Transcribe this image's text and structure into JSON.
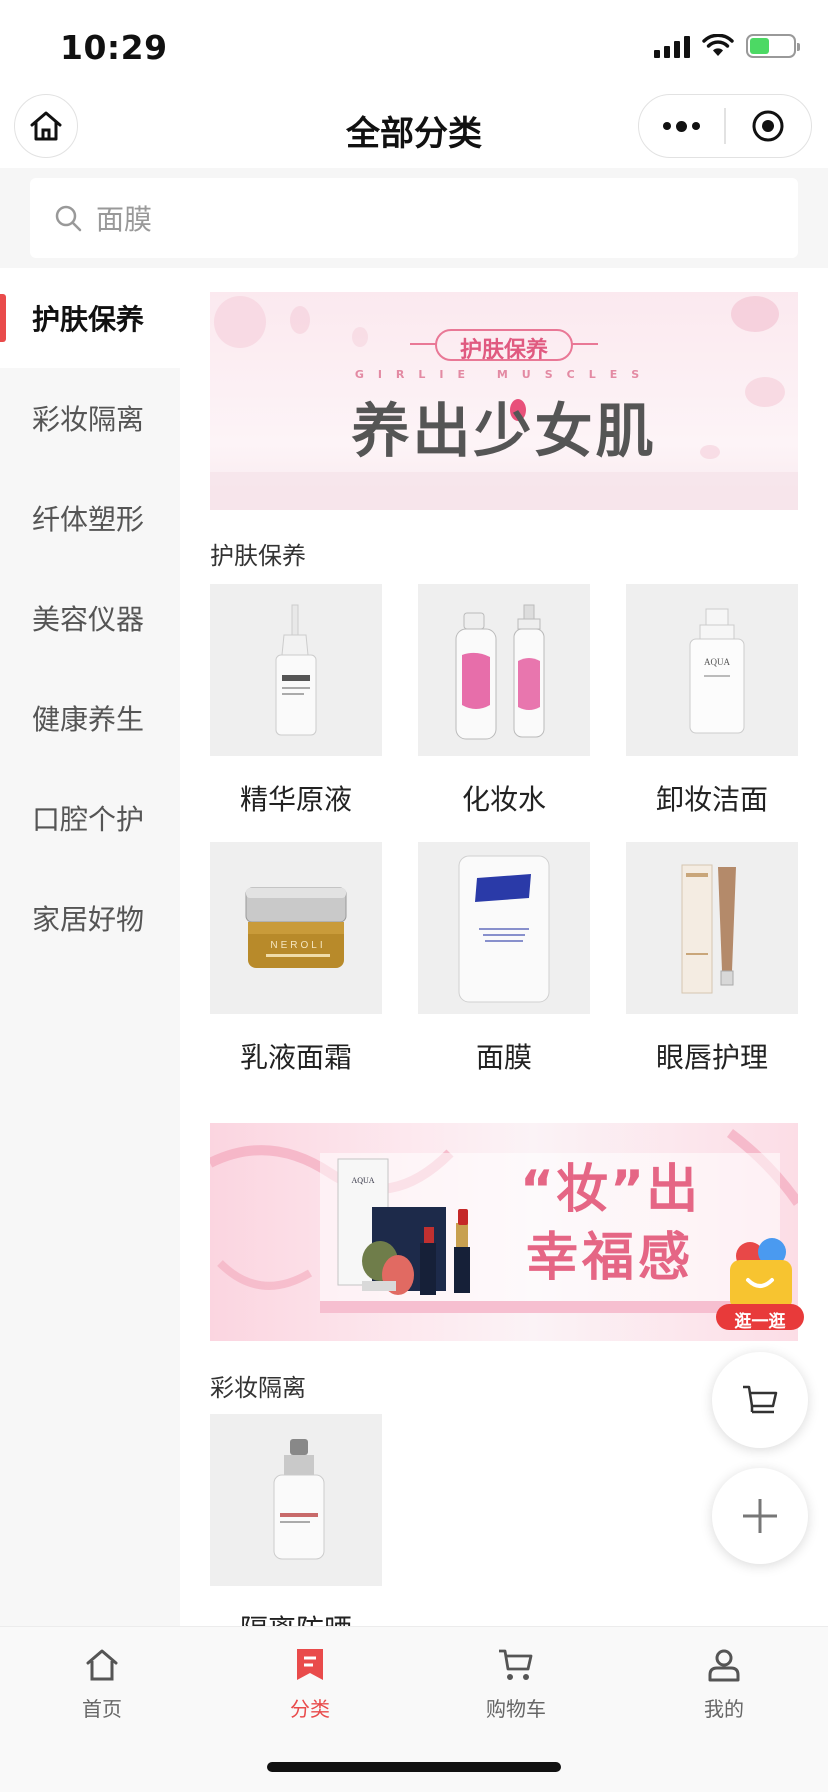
{
  "status": {
    "time": "10:29"
  },
  "nav": {
    "title": "全部分类"
  },
  "search": {
    "placeholder": "面膜"
  },
  "sidebar": {
    "items": [
      {
        "label": "护肤保养"
      },
      {
        "label": "彩妆隔离"
      },
      {
        "label": "纤体塑形"
      },
      {
        "label": "美容仪器"
      },
      {
        "label": "健康养生"
      },
      {
        "label": "口腔个护"
      },
      {
        "label": "家居好物"
      }
    ]
  },
  "banners": {
    "skincare": {
      "tag": "护肤保养",
      "subtitle": "GIRLIE MUSCLES",
      "headline": "养出少女肌"
    },
    "makeup": {
      "line1": "“妆”出",
      "line2": "幸福感"
    }
  },
  "sections": [
    {
      "title": "护肤保养",
      "items": [
        {
          "label": "精华原液"
        },
        {
          "label": "化妆水"
        },
        {
          "label": "卸妆洁面"
        },
        {
          "label": "乳液面霜"
        },
        {
          "label": "面膜"
        },
        {
          "label": "眼唇护理"
        }
      ]
    },
    {
      "title": "彩妆隔离",
      "items": [
        {
          "label": "隔离防晒"
        }
      ]
    }
  ],
  "floating": {
    "promo_label": "逛一逛"
  },
  "tabs": [
    {
      "label": "首页"
    },
    {
      "label": "分类"
    },
    {
      "label": "购物车"
    },
    {
      "label": "我的"
    }
  ],
  "colors": {
    "accent": "#e94b4b",
    "sidebar_bg": "#f7f7f7",
    "thumb_bg": "#efefef"
  }
}
